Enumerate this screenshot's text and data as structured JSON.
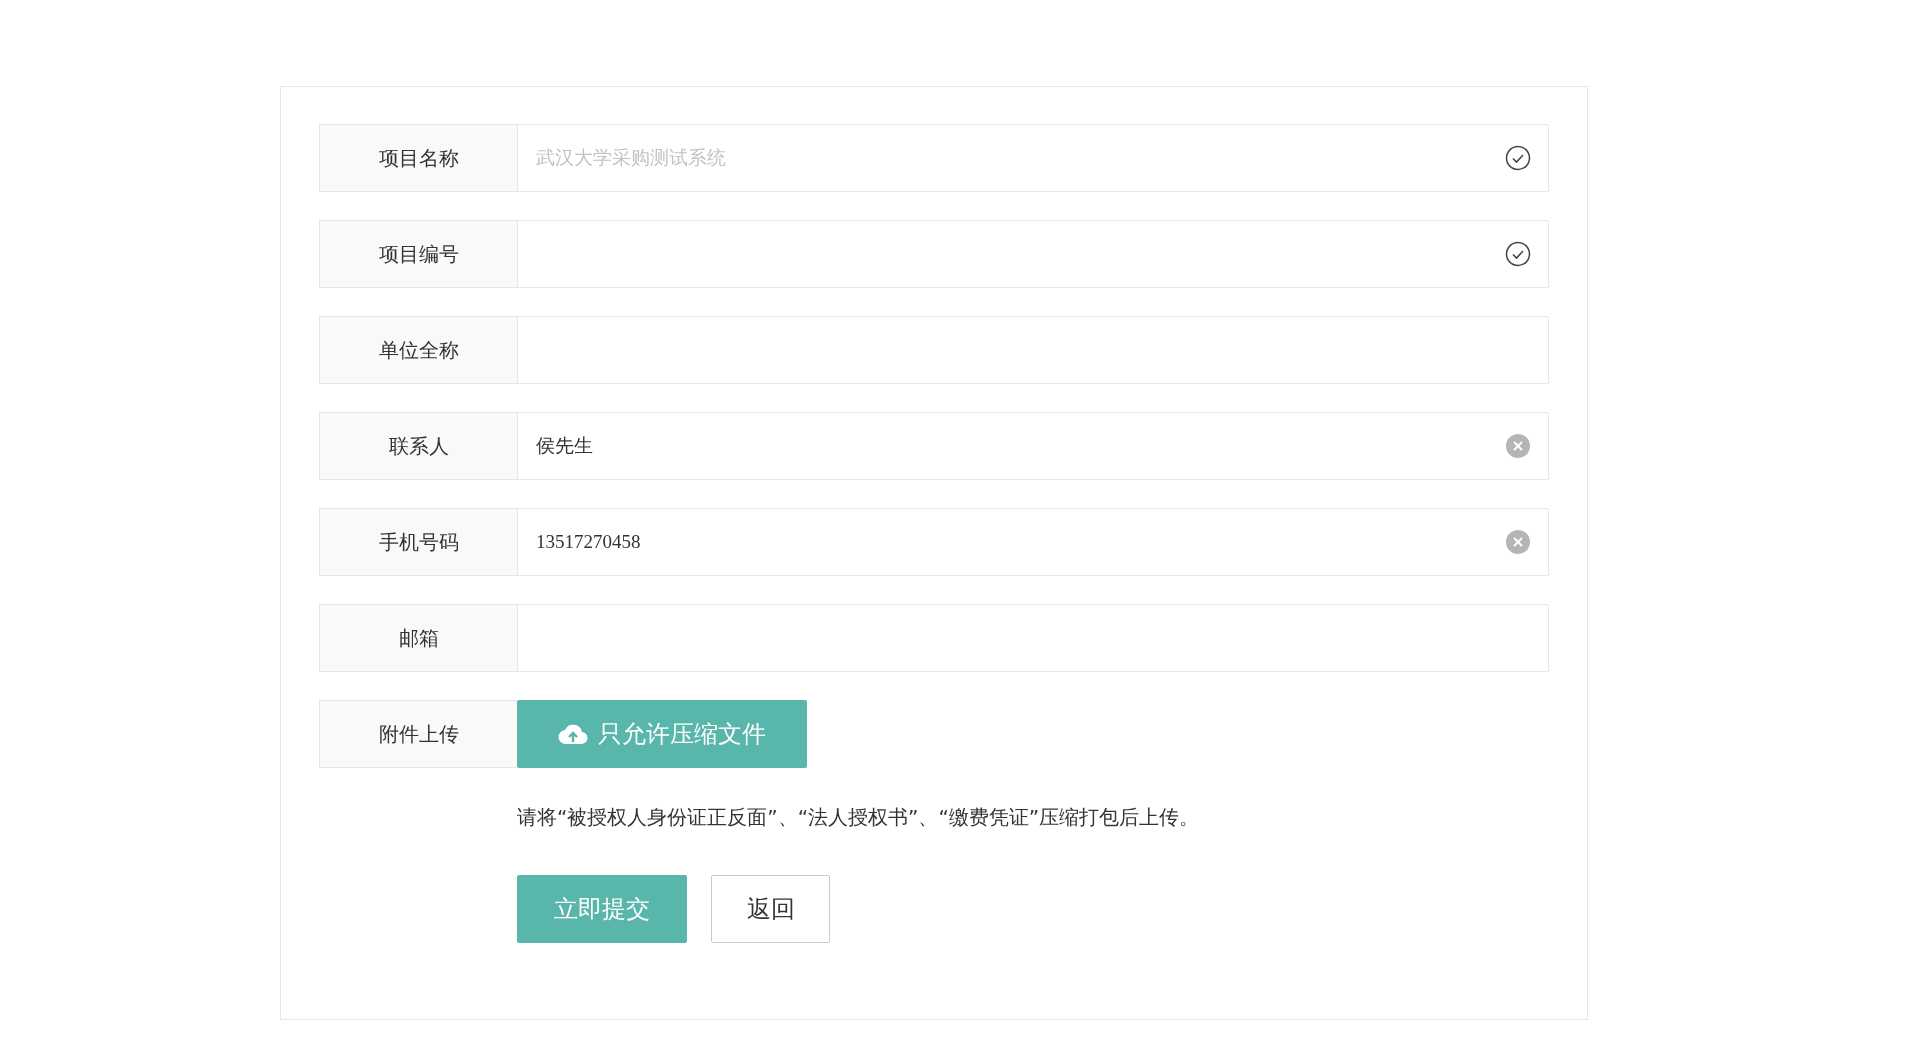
{
  "form": {
    "fields": [
      {
        "label": "项目名称",
        "placeholder": "武汉大学采购测试系统",
        "kind": "validated"
      },
      {
        "label": "项目编号",
        "kind": "validated"
      },
      {
        "label": "单位全称",
        "kind": "plain"
      },
      {
        "label": "联系人",
        "value": "侯先生",
        "kind": "clearable"
      },
      {
        "label": "手机号码",
        "value": "13517270458",
        "kind": "clearable"
      },
      {
        "label": "邮箱",
        "kind": "plain"
      }
    ],
    "upload": {
      "label": "附件上传",
      "button": "只允许压缩文件"
    },
    "hint": "请将“被授权人身份证正反面”、“法人授权书”、“缴费凭证”压缩打包后上传。",
    "actions": [
      {
        "label": "立即提交",
        "kind": "primary"
      },
      {
        "label": "返回",
        "kind": "default"
      }
    ]
  }
}
